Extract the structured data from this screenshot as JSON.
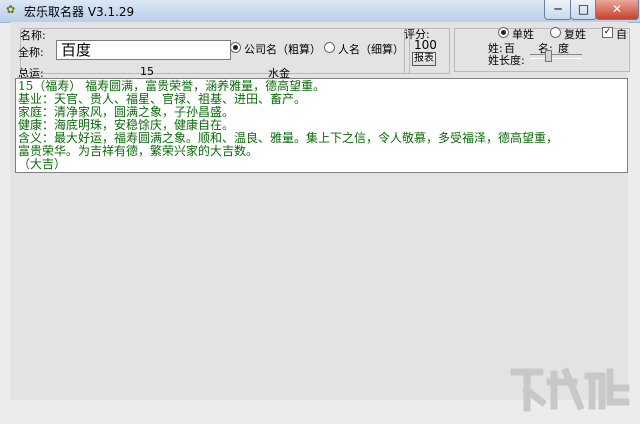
{
  "window": {
    "title": "宏乐取名器 V3.1.29",
    "min_glyph": "─",
    "max_glyph": "□",
    "close_glyph": "✕"
  },
  "naming": {
    "name_label": "名称:",
    "fullname_label": "全称:",
    "fullname_value": "百度",
    "option_company": "公司名（粗算）",
    "option_person": "人名（细算）",
    "selected": "company"
  },
  "score": {
    "label": "评分:",
    "value": "100",
    "report_button": "报表"
  },
  "options": {
    "single_label": "单姓",
    "double_label": "复姓",
    "auto_label": "自动",
    "selected": "single",
    "auto_checked": true,
    "surname_label": "姓:",
    "surname_value": "百",
    "given_label": "名:",
    "given_value": "度",
    "length_label": "姓长度:"
  },
  "summary": {
    "label": "总运:",
    "number": "15",
    "element": "水金"
  },
  "result_lines": [
    "15（福寿） 福寿圆满，富贵荣誉，涵养雅量，德高望重。",
    "基业：天官、贵人、福星、官禄、祖基、进田、畜产。",
    "家庭：清净家风，圆满之象，子孙昌盛。",
    "健康：海底明珠，安稳馀庆，健康自在。",
    "含义：最大好运，福寿圆满之象。顺和、温良、雅量。集上下之信，令人敬慕，多受福泽，德高望重，",
    "富贵荣华。为吉祥有德，繁荣兴家的大吉数。",
    "（大吉）"
  ],
  "colors": {
    "result_text": "#0b6a0b",
    "panel_bg": "#e3e3e3"
  }
}
